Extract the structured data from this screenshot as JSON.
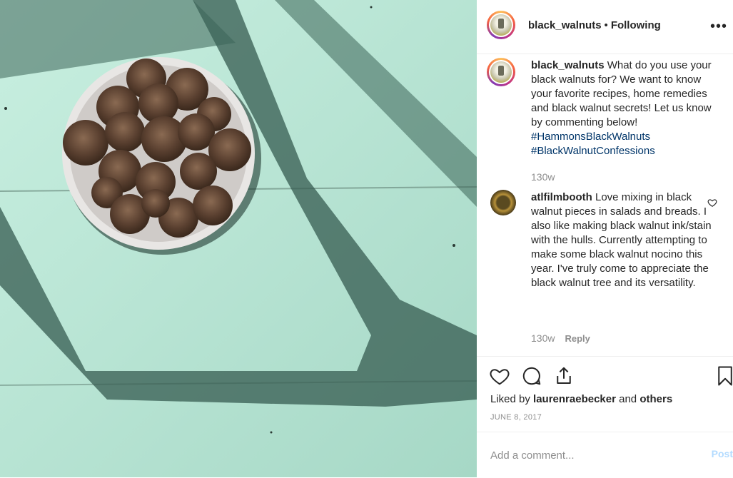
{
  "post": {
    "image_alt": "bowl of black walnuts on a mint-green wooden table",
    "image_icon": "walnut-bowl-photo"
  },
  "header": {
    "username": "black_walnuts",
    "separator": "•",
    "follow_status": "Following",
    "more_icon": "more-horizontal-icon",
    "more_glyph": "•••"
  },
  "caption": {
    "username": "black_walnuts",
    "text": "What do you use your black walnuts for? We want to know your favorite recipes, home remedies and black walnut secrets! Let us know by commenting below!",
    "hashtags": [
      "#HammonsBlackWalnuts",
      "#BlackWalnutConfessions"
    ],
    "age": "130w"
  },
  "comment": {
    "username": "atlfilmbooth",
    "text": "Love mixing in black walnut pieces in salads and breads. I also like making black walnut ink/stain with the hulls. Currently attempting to make some black walnut nocino this year. I've truly come to appreciate the black walnut tree and its versatility.",
    "age": "130w",
    "reply_label": "Reply",
    "like_icon": "heart-outline-icon"
  },
  "actions": {
    "icons": [
      "heart-icon",
      "comment-icon",
      "share-icon",
      "bookmark-icon"
    ]
  },
  "likes": {
    "prefix": "Liked by",
    "user": "laurenraebecker",
    "conjunction": "and",
    "others": "others"
  },
  "date": "JUNE 8, 2017",
  "add_comment": {
    "placeholder": "Add a comment...",
    "post_label": "Post"
  },
  "colors": {
    "table": "#a8dccb",
    "link": "#003569",
    "muted": "#8e8e8e",
    "post_disabled": "#b3dbff"
  }
}
